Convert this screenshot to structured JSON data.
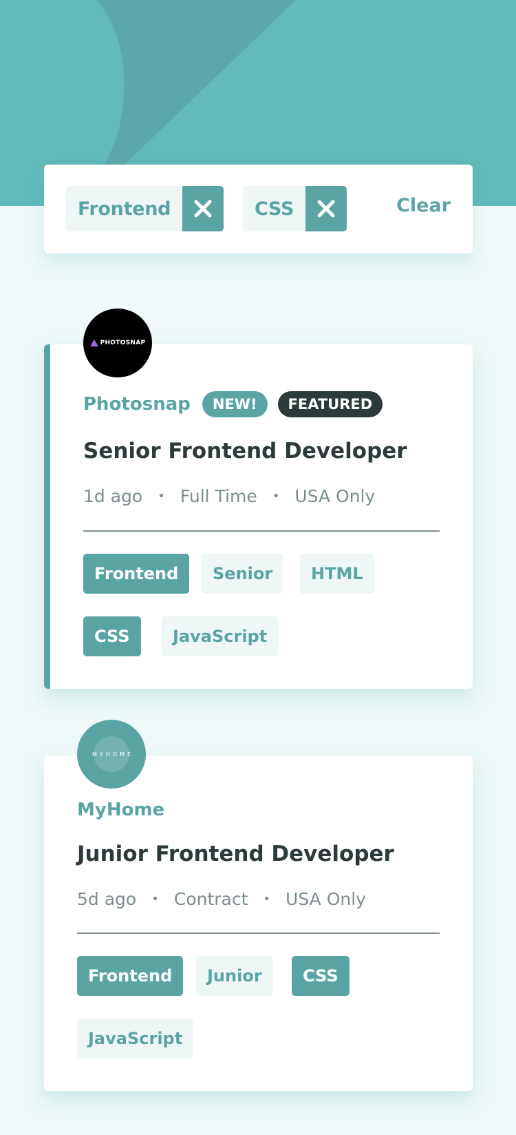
{
  "colors": {
    "primary": "#5ba4a4",
    "header_bg": "#62b9b9",
    "page_bg": "#eff9f9",
    "dark": "#2c3a3a",
    "muted": "#7b8e8e"
  },
  "filters": {
    "active": [
      {
        "label": "Frontend",
        "remove_icon": "close-icon"
      },
      {
        "label": "CSS",
        "remove_icon": "close-icon"
      }
    ],
    "clear_label": "Clear"
  },
  "jobs": [
    {
      "logo_text": "PHOTOSNAP",
      "company": "Photosnap",
      "new_badge": "NEW!",
      "featured_badge": "FEATURED",
      "position": "Senior Frontend Developer",
      "posted": "1d ago",
      "contract": "Full Time",
      "location": "USA Only",
      "tags": [
        "Frontend",
        "Senior",
        "HTML",
        "CSS",
        "JavaScript"
      ]
    },
    {
      "logo_text": "MYHOME",
      "company": "MyHome",
      "position": "Junior Frontend Developer",
      "posted": "5d ago",
      "contract": "Contract",
      "location": "USA Only",
      "tags": [
        "Frontend",
        "Junior",
        "CSS",
        "JavaScript"
      ]
    }
  ]
}
